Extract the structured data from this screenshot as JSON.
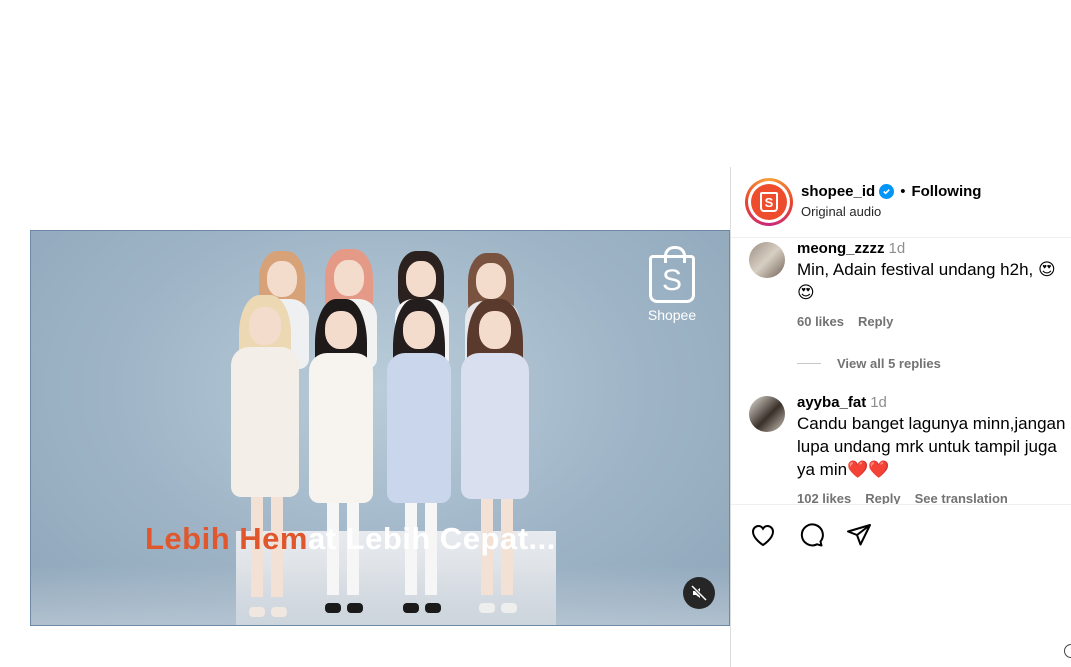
{
  "video": {
    "brand_logo_text": "Shopee",
    "brand_logo_letter": "S",
    "caption_part1": "Lebih Hem",
    "caption_part2": "at Lebih Cepat...",
    "mute_icon": "speaker-muted-icon"
  },
  "post": {
    "username": "shopee_id",
    "separator": "•",
    "follow_state": "Following",
    "audio": "Original audio",
    "avatar_letter": "S",
    "colors": {
      "brand": "#ee4d2d",
      "verified": "#0095f6"
    }
  },
  "comments": [
    {
      "username": "meong_zzzz",
      "time": "1d",
      "text": "Min, Adain festival undang h2h, 😍😍",
      "likes": "60 likes",
      "reply": "Reply",
      "view_replies": "View all 5 replies"
    },
    {
      "username": "ayyba_fat",
      "time": "1d",
      "text": "Candu banget lagunya minn,jangan lupa undang mrk untuk tampil juga ya min❤️❤️",
      "likes": "102 likes",
      "reply": "Reply",
      "translation": "See translation"
    }
  ],
  "actions": {
    "like_icon": "heart-icon",
    "comment_icon": "comment-icon",
    "share_icon": "share-icon"
  }
}
